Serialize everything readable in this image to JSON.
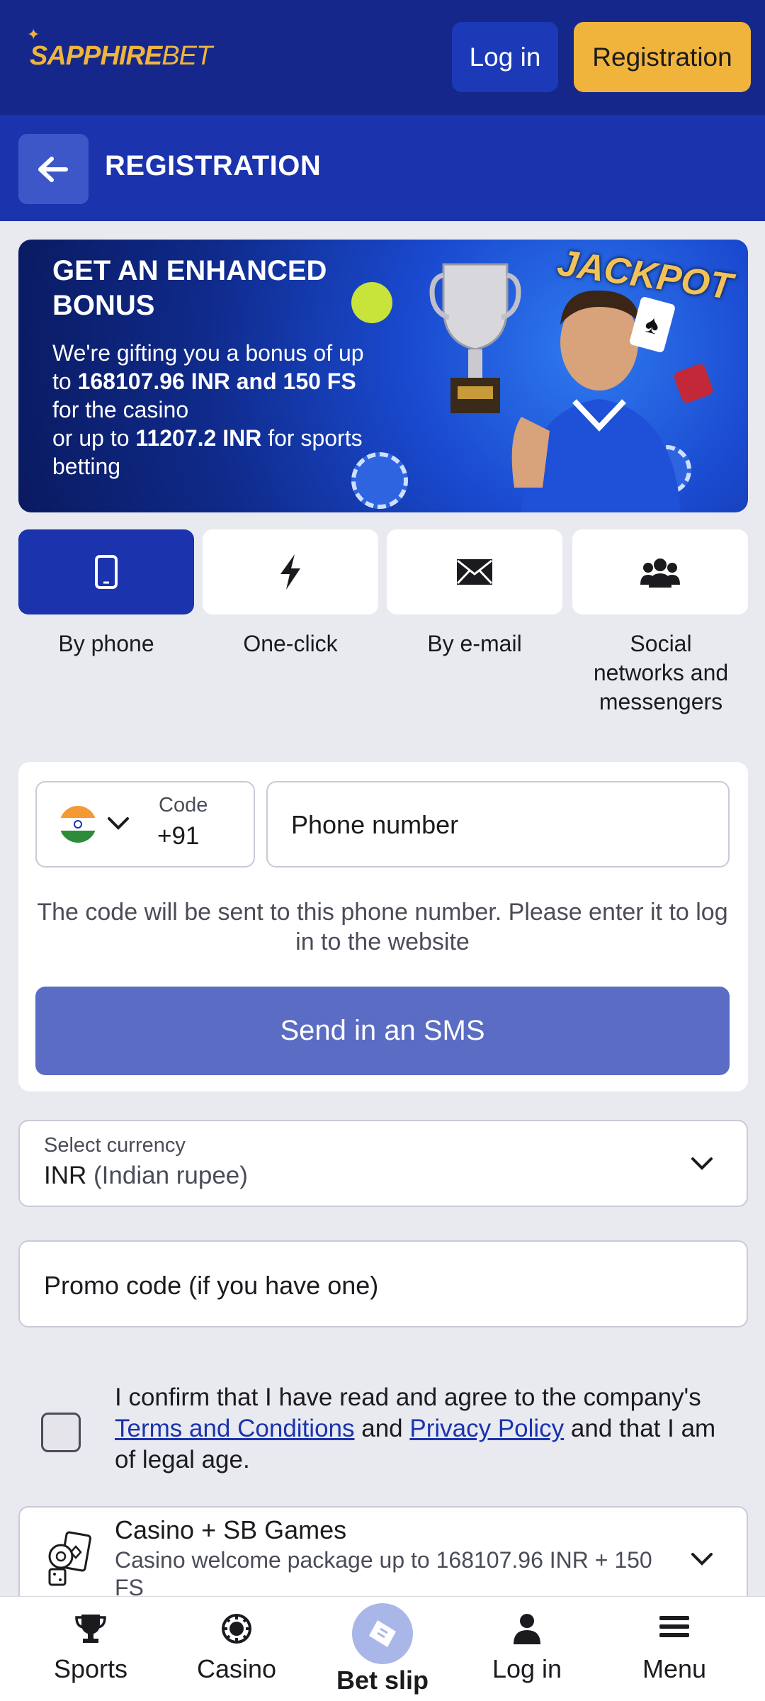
{
  "header": {
    "logo_main": "SAPPHIRE",
    "logo_thin": "BET",
    "login_label": "Log in",
    "registration_label": "Registration"
  },
  "subheader": {
    "title": "REGISTRATION"
  },
  "banner": {
    "title": "GET AN ENHANCED BONUS",
    "line1": "We're gifting you a bonus of up",
    "line2_prefix": "to ",
    "line2_bold": "168107.96 INR and 150 FS",
    "line3": "for the casino",
    "line4_prefix": "or up to ",
    "line4_bold": "11207.2 INR",
    "line4_suffix": " for sports",
    "line5": "betting",
    "jackpot_text": "JACKPOT"
  },
  "tabs": [
    {
      "label": "By phone",
      "icon": "phone-icon",
      "active": true
    },
    {
      "label": "One-click",
      "icon": "lightning-icon",
      "active": false
    },
    {
      "label": "By e-mail",
      "icon": "envelope-icon",
      "active": false
    },
    {
      "label": "Social networks and messengers",
      "icon": "users-icon",
      "active": false
    }
  ],
  "form": {
    "code_label": "Code",
    "code_value": "+91",
    "phone_placeholder": "Phone number",
    "hint": "The code will be sent to this phone number. Please enter it to log in to the website",
    "sms_button": "Send in an SMS"
  },
  "currency": {
    "label": "Select currency",
    "code": "INR",
    "name": "(Indian rupee)"
  },
  "promo": {
    "placeholder": "Promo code (if you have one)"
  },
  "agreement": {
    "text1": "I confirm that I have read and agree to the company's ",
    "terms_link": "Terms and Conditions",
    "text2": " and ",
    "privacy_link": "Privacy Policy",
    "text3": " and that I am of legal age."
  },
  "bonus": {
    "title": "Casino + SB Games",
    "description": "Casino welcome package up to 168107.96 INR + 150 FS"
  },
  "bottom_nav": [
    {
      "label": "Sports",
      "icon": "trophy-icon"
    },
    {
      "label": "Casino",
      "icon": "casino-chip-icon"
    },
    {
      "label": "Bet slip",
      "icon": "ticket-icon"
    },
    {
      "label": "Log in",
      "icon": "user-icon"
    },
    {
      "label": "Menu",
      "icon": "menu-icon"
    }
  ],
  "colors": {
    "header_bg": "#15278a",
    "subheader_bg": "#1b33ad",
    "accent_yellow": "#f0b43c",
    "sms_button": "#5a6cc4",
    "page_bg": "#e9eaf0"
  }
}
